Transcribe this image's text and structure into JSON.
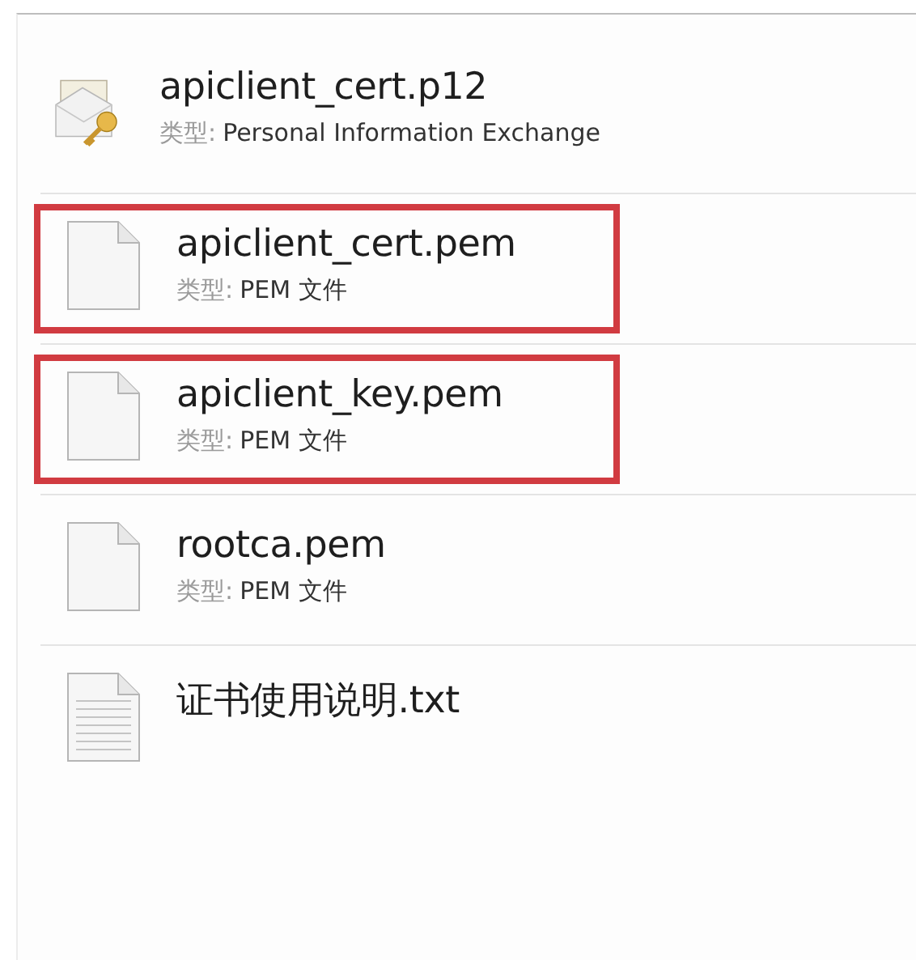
{
  "files": [
    {
      "name": "apiclient_cert.p12",
      "kind": "certificate",
      "type_label": "类型:",
      "type_value": "Personal Information Exchange",
      "highlighted": false
    },
    {
      "name": "apiclient_cert.pem",
      "kind": "blank",
      "type_label": "类型:",
      "type_value": "PEM 文件",
      "highlighted": true
    },
    {
      "name": "apiclient_key.pem",
      "kind": "blank",
      "type_label": "类型:",
      "type_value": "PEM 文件",
      "highlighted": true
    },
    {
      "name": "rootca.pem",
      "kind": "blank",
      "type_label": "类型:",
      "type_value": "PEM 文件",
      "highlighted": false
    },
    {
      "name": "证书使用说明.txt",
      "kind": "text",
      "highlighted": false
    }
  ]
}
